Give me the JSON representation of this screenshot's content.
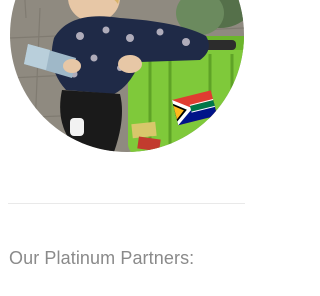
{
  "partners_section": {
    "heading": "Our Platinum Partners:"
  },
  "featured_image": {
    "shape": "circle",
    "depicts": [
      "person",
      "map",
      "green-suitcase",
      "south-africa-flag-sticker"
    ],
    "colors": {
      "suitcase": "#7fc93a",
      "shirt": "#1f2a47",
      "pavement": "#8f8a80",
      "heading_text": "#8a8a8a",
      "divider": "#e9e9e9"
    }
  }
}
